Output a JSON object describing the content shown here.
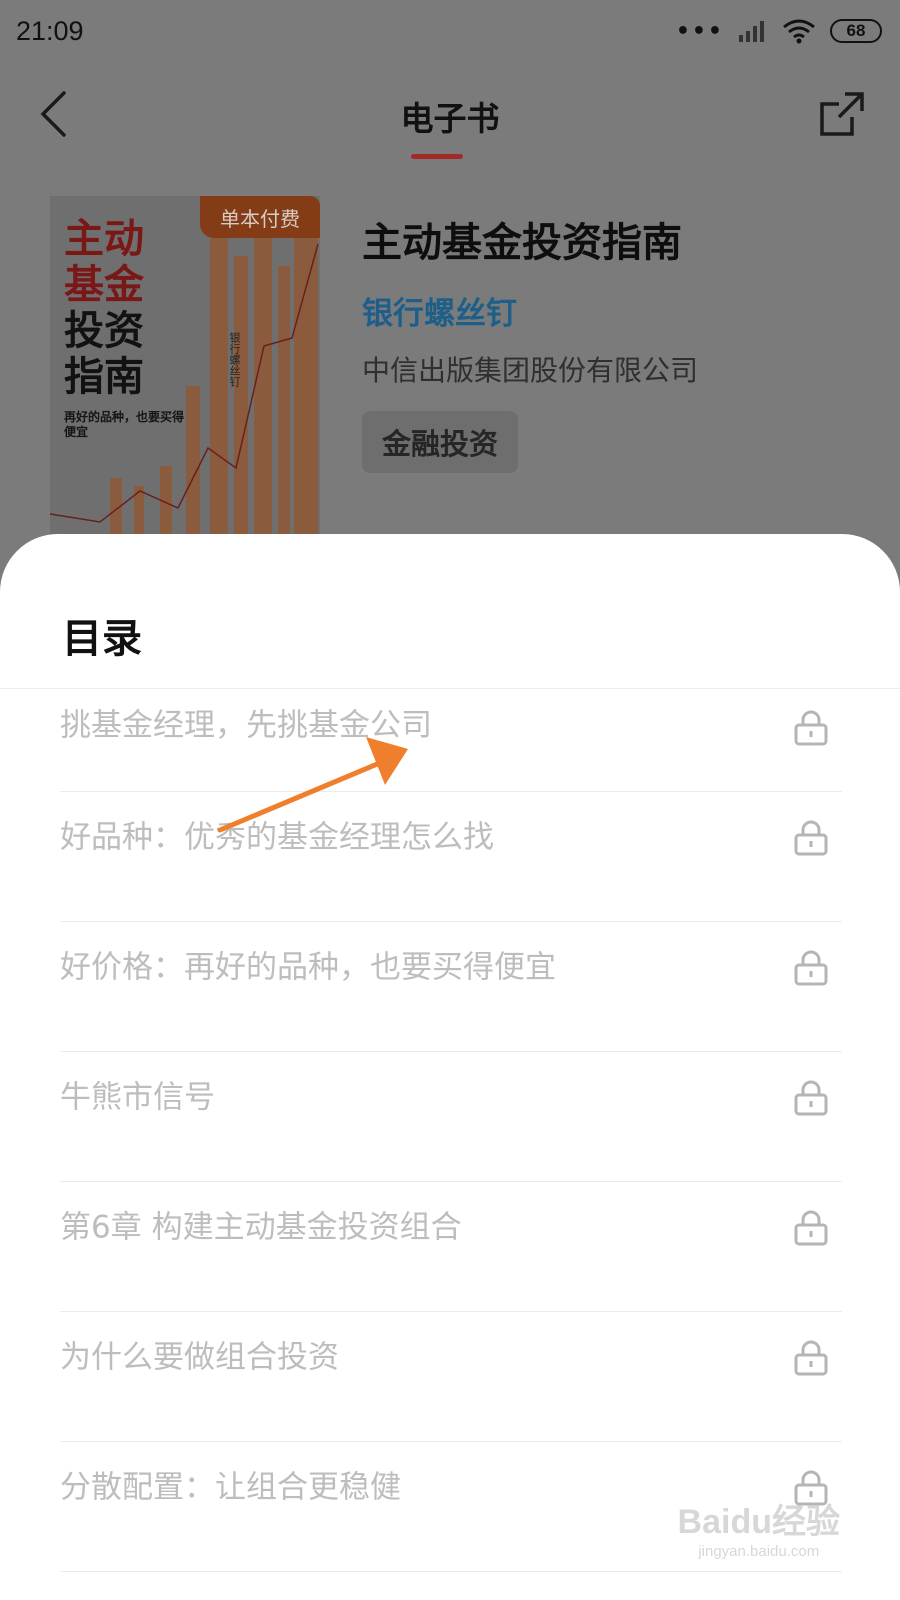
{
  "status_bar": {
    "time": "21:09",
    "battery": "68"
  },
  "nav": {
    "title": "电子书"
  },
  "book": {
    "cover_lines": [
      "主动",
      "基金",
      "投资",
      "指南"
    ],
    "cover_subtitle": "再好的品种，也要买得便宜",
    "cover_author_vertical": "银行螺丝钉",
    "paid_tag": "单本付费",
    "title": "主动基金投资指南",
    "author": "银行螺丝钉",
    "publisher": "中信出版集团股份有限公司",
    "category": "金融投资"
  },
  "toc": {
    "title": "目录",
    "items": [
      "挑基金经理，先挑基金公司",
      "好品种：优秀的基金经理怎么找",
      "好价格：再好的品种，也要买得便宜",
      "牛熊市信号",
      "第6章 构建主动基金投资组合",
      "为什么要做组合投资",
      "分散配置：让组合更稳健"
    ]
  },
  "watermark": {
    "logo": "Baidu经验",
    "url": "jingyan.baidu.com"
  },
  "colors": {
    "accent": "#c0392b",
    "author_link": "#1e7ab8",
    "annotation_arrow": "#f07f2d",
    "overlay": "#7b7b7b"
  }
}
